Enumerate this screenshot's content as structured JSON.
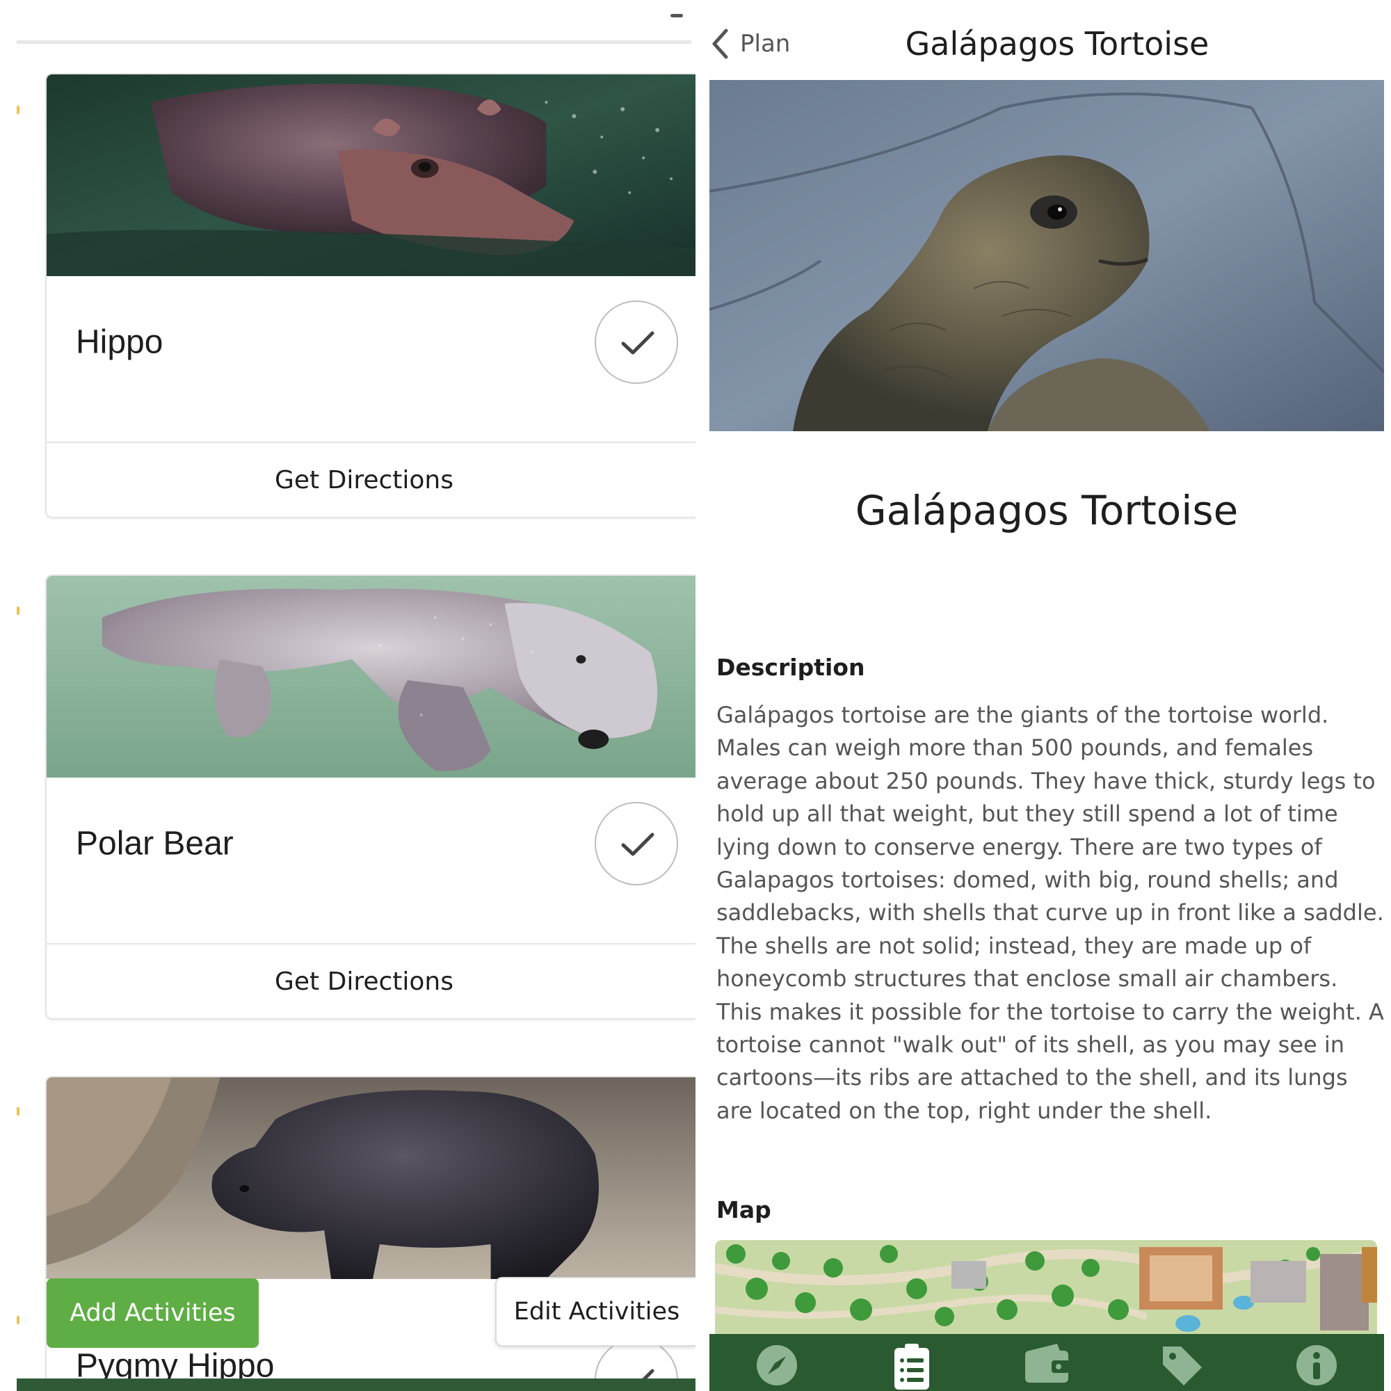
{
  "left_panel": {
    "cards": [
      {
        "name": "Hippo",
        "directions_label": "Get Directions",
        "checked": true
      },
      {
        "name": "Polar Bear",
        "directions_label": "Get Directions",
        "checked": true
      },
      {
        "name": "Pygmy Hippo",
        "checked": true
      }
    ],
    "actions": {
      "add_label": "Add Activities",
      "edit_label": "Edit Activities"
    },
    "colors": {
      "add_button": "#5fae45",
      "bottom_bar": "#2f5a35"
    }
  },
  "right_panel": {
    "nav": {
      "back_label": "Plan",
      "title": "Galápagos Tortoise"
    },
    "animal_title": "Galápagos Tortoise",
    "description_heading": "Description",
    "description": "Galápagos tortoise are the giants of the tortoise world. Males can weigh more than 500 pounds, and females average about 250 pounds. They have thick, sturdy legs to hold up all that weight, but they still spend a lot of time lying down to conserve energy. There are two types of Galapagos tortoises: domed, with big, round shells; and saddlebacks, with shells that curve up in front like a saddle. The shells are not solid; instead, they are made up of honeycomb structures that enclose small air chambers. This makes it possible for the tortoise to carry the weight. A tortoise cannot \"walk out\" of its shell, as you may see in cartoons—its ribs are attached to the shell, and its lungs are located on the top, right under the shell.",
    "map_heading": "Map",
    "tabbar": {
      "tabs": [
        "compass-icon",
        "checklist-icon",
        "wallet-icon",
        "tag-icon",
        "info-icon"
      ],
      "active_tab": "checklist-icon",
      "colors": {
        "background": "#2a5a30",
        "icon": "#8fb493",
        "active_icon": "#ffffff"
      }
    }
  }
}
